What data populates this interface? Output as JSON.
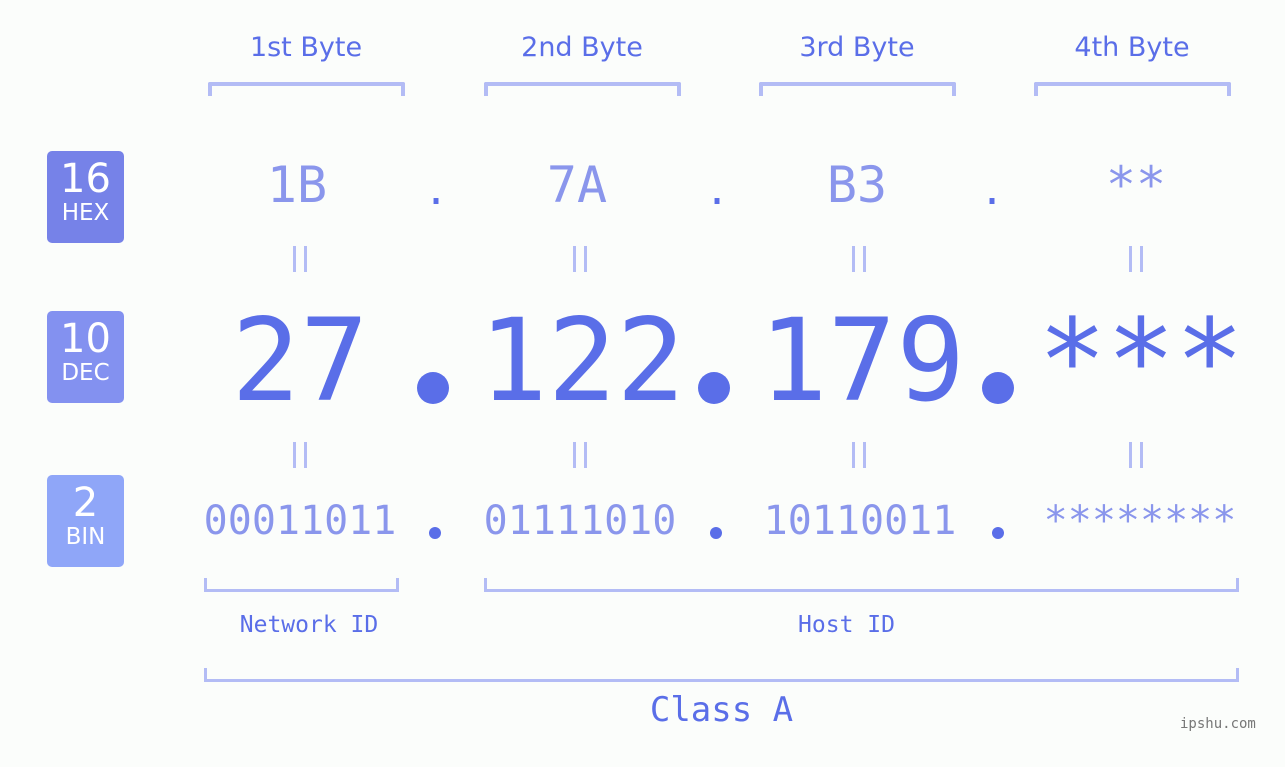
{
  "byte_headers": [
    "1st Byte",
    "2nd Byte",
    "3rd Byte",
    "4th Byte"
  ],
  "rows": {
    "hex": {
      "base": "16",
      "label": "HEX",
      "color": "#7682e8",
      "values": [
        "1B",
        "7A",
        "B3",
        "**"
      ]
    },
    "dec": {
      "base": "10",
      "label": "DEC",
      "color": "#8391f0",
      "values": [
        "27",
        "122",
        "179",
        "***"
      ]
    },
    "bin": {
      "base": "2",
      "label": "BIN",
      "color": "#8fa6f8",
      "values": [
        "00011011",
        "01111010",
        "10110011",
        "********"
      ]
    }
  },
  "separator": ".",
  "equals": "=",
  "segments": {
    "network": "Network ID",
    "host": "Host ID"
  },
  "class_label": "Class A",
  "watermark": "ipshu.com",
  "colors": {
    "primary": "#5a6ee8",
    "light": "#8a96ec",
    "bracket": "#b3bcf5",
    "background": "#fbfdfb"
  }
}
